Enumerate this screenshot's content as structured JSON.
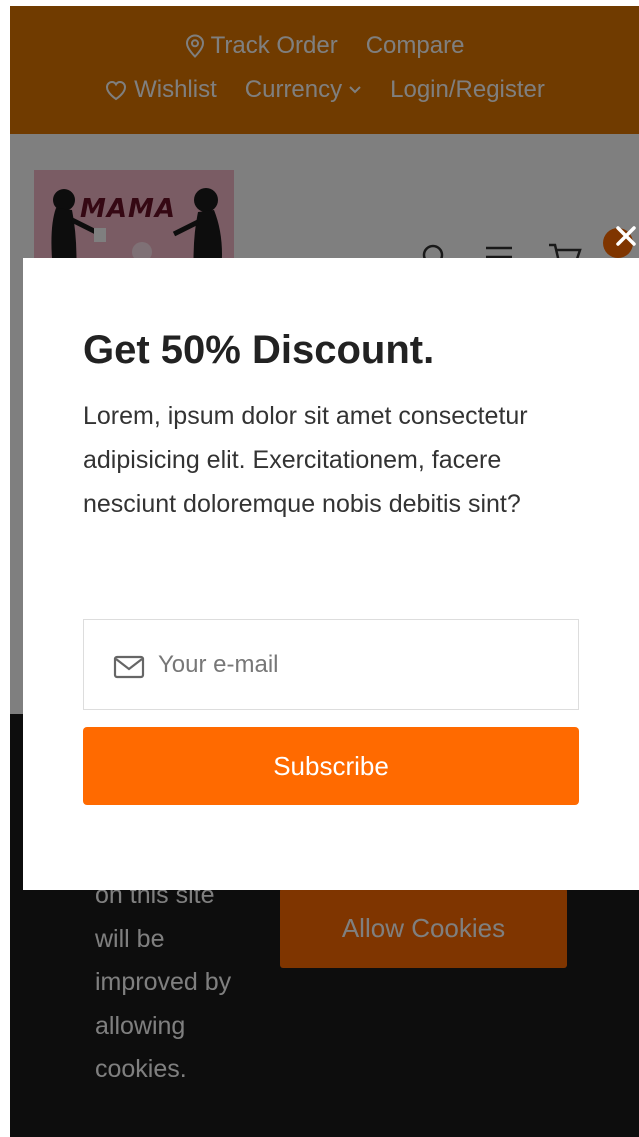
{
  "topbar": {
    "track_order": "Track Order",
    "compare": "Compare",
    "wishlist": "Wishlist",
    "currency": "Currency",
    "login_register": "Login/Register"
  },
  "logo": {
    "text": "MAMA"
  },
  "cookie_notice": {
    "message": "on this site\nwill be\nimproved by\nallowing\ncookies.",
    "allow_label": "Allow Cookies"
  },
  "popup": {
    "title": "Get 50% Discount.",
    "description": "Lorem, ipsum dolor sit amet consectetur adipisicing elit. Exercitationem, facere nesciunt doloremque nobis debitis sint?",
    "email_placeholder": "Your e-mail",
    "email_value": "",
    "subscribe_label": "Subscribe"
  },
  "colors": {
    "brand_orange": "#ff6a00",
    "topbar_orange": "#e07700",
    "overlay": "rgba(0,0,0,0.5)",
    "dark_footer": "#1b1b1b"
  },
  "icons": [
    "location-pin-icon",
    "heart-icon",
    "chevron-down-icon",
    "search-icon",
    "menu-icon",
    "cart-icon",
    "close-icon",
    "envelope-icon"
  ]
}
